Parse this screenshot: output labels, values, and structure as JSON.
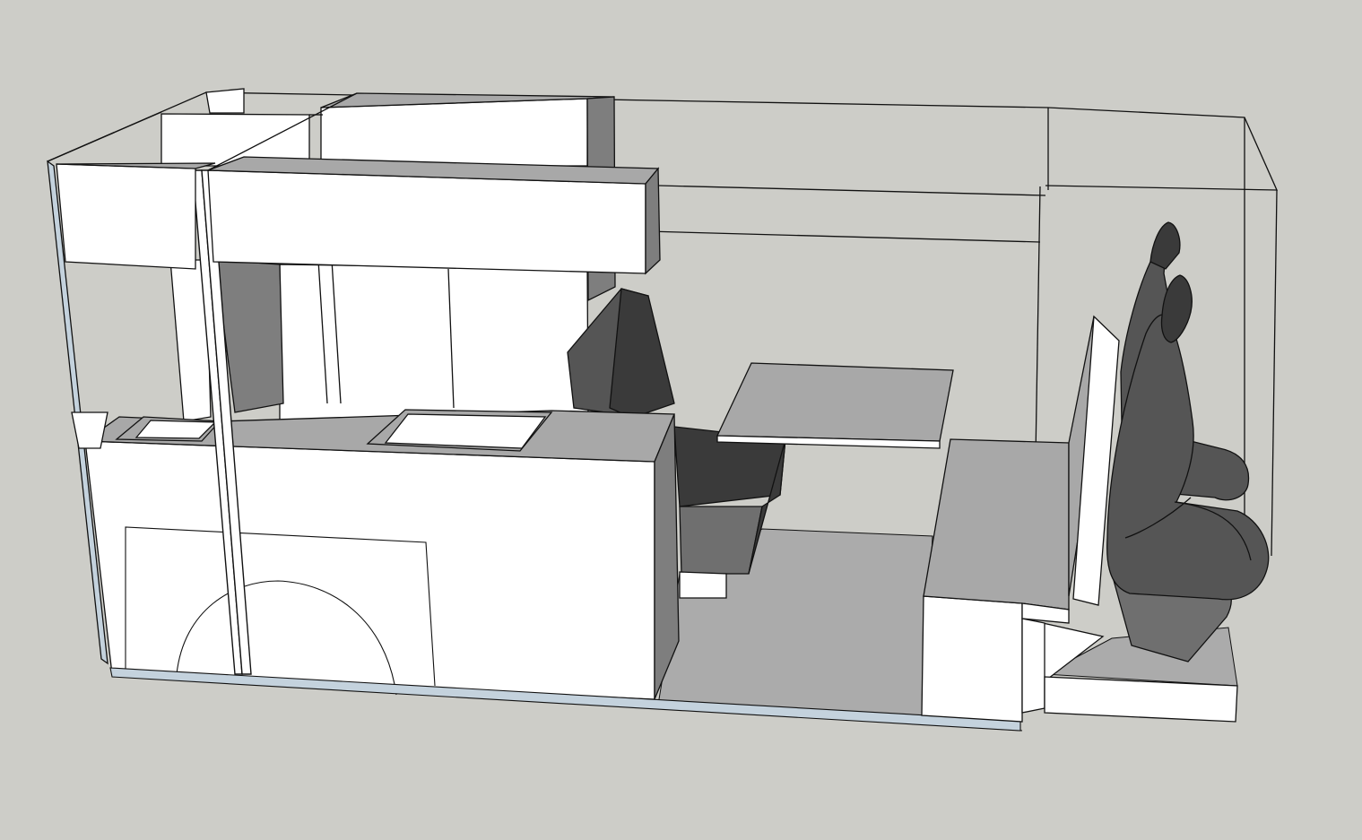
{
  "view": {
    "background": "#cdcdc8",
    "outline": "#111111",
    "glass_edge": "#c4d2dd"
  },
  "shades": {
    "face_light": "#ffffff",
    "face_mid": "#a8a8a8",
    "face_dark": "#7e7e7e",
    "floor": "#ababab",
    "seat_dark": "#3a3a3a",
    "seat_mid": "#555555",
    "seat_light": "#6f6f6f"
  },
  "components": [
    "camper-van-shell",
    "overhead-cabinets",
    "kitchen-counter",
    "sink",
    "swivel-seat",
    "dining-table",
    "bench-seat",
    "cab-seats",
    "wheel-arch"
  ]
}
